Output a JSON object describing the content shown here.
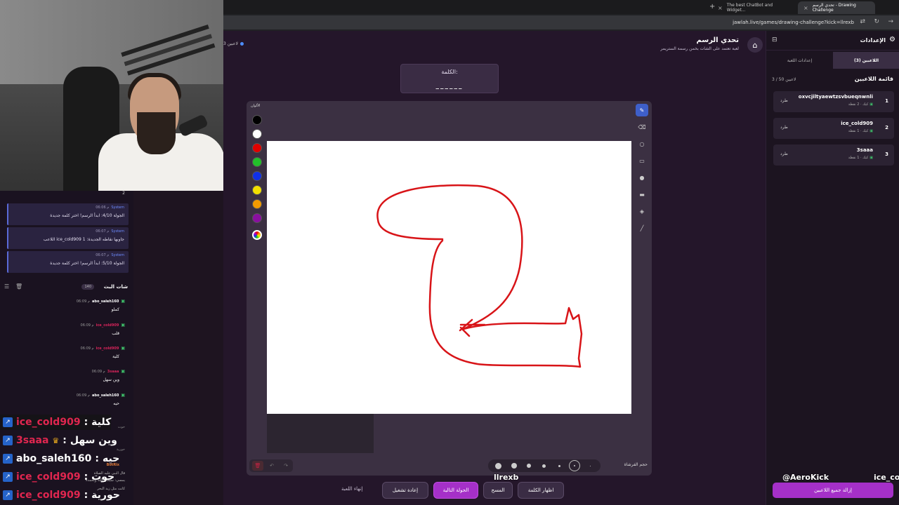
{
  "browser": {
    "tabs": [
      {
        "label": "تحدي الرسم - Drawing Challenge",
        "active": true
      },
      {
        "label": "The best ChatBot and Widget...",
        "active": false
      }
    ],
    "url": "jawlah.live/games/drawing-challenge?kick=llrexb"
  },
  "left_panel": {
    "system_messages": [
      {
        "sender": "System",
        "time": "06:06 م",
        "text": "الجولة 4/10: ابدأ الرسم! اختر كلمة جديدة"
      },
      {
        "sender": "System",
        "time": "06:07 م",
        "text": "اللاعب ice_cold909 جاوبها نقاطه الجديدة: 1"
      },
      {
        "sender": "System",
        "time": "06:07 م",
        "text": "الجولة 5/10: ابدأ الرسم! اختر كلمة جديدة"
      }
    ],
    "chat_title": "شات البث",
    "chat_count": "140",
    "chat_messages": [
      {
        "user": "abo_saleh160",
        "time": "06:09 م",
        "text": "كملو",
        "color": "white"
      },
      {
        "user": "ice_cold909",
        "time": "06:09 م",
        "text": "قلب",
        "color": "red"
      },
      {
        "user": "ice_cold909",
        "time": "06:09 م",
        "text": "كلية",
        "color": "red"
      },
      {
        "user": "3saaa",
        "time": "06:09 م",
        "text": "وين سهل",
        "color": "red"
      },
      {
        "user": "abo_saleh160",
        "time": "06:09 م",
        "text": "حيه",
        "color": "white"
      }
    ],
    "partial_lines": [
      "حوت",
      "حورية",
      "BotRix",
      "قال النبي عليه الصلاة",
      "يمسي: سبحان الله وبحمده",
      "كانت مثل زبد البحر"
    ]
  },
  "overlay_chat": [
    {
      "user": "ice_cold909",
      "sep": ":",
      "msg": "كلية",
      "user_color": "#e0264f",
      "crown": false
    },
    {
      "user": "3saaa",
      "sep": ":",
      "msg": "وين سهل",
      "user_color": "#e0264f",
      "crown": true
    },
    {
      "user": "abo_saleh160",
      "sep": ":",
      "msg": "حيه",
      "user_color": "#ffffff",
      "crown": false
    },
    {
      "user": "ice_cold909",
      "sep": ":",
      "msg": "حوت",
      "user_color": "#e0264f",
      "crown": false
    },
    {
      "user": "ice_cold909",
      "sep": ":",
      "msg": "حورية",
      "user_color": "#e0264f",
      "crown": false
    }
  ],
  "game": {
    "players_online": "3 لاعبين",
    "title": "تحدي الرسم",
    "subtitle": "لعبة تعتمد على الشات بخمن رسمة الستريمر",
    "word_label": "الكلمة:",
    "word_mask": "______",
    "colors_label": "الألوان",
    "palette": [
      "#000000",
      "#ffffff",
      "#e00000",
      "#22c02a",
      "#1030e8",
      "#f2e000",
      "#f29a00",
      "#8a0fa0"
    ],
    "brush_size_label": "حجم الفرشاة",
    "tools": [
      "pencil-icon",
      "eraser-icon",
      "circle-icon",
      "rectangle-icon",
      "dot-icon",
      "square-fill-icon",
      "bucket-icon",
      "line-icon"
    ]
  },
  "actions": {
    "end_game": "إنهاء اللعبة",
    "restart": "إعادة تشغيل",
    "next_round": "الجولة التالية",
    "clear": "المسح",
    "reveal_word": "اظهار الكلمة"
  },
  "sidebar": {
    "title": "الإعدادات",
    "tab_players": "اللاعبين (3)",
    "tab_settings": "إعدادات اللعبة",
    "list_title": "قائمة اللاعبين",
    "list_count": "3 / 50 لاعبين",
    "kick_label": "طرد",
    "players": [
      {
        "rank": "1",
        "name": "oxvcjiltyaewtzsvbueqnwnli",
        "points": "كيك · 2 نقطة"
      },
      {
        "rank": "2",
        "name": "ice_cold909",
        "points": "كيك · 1 نقطة"
      },
      {
        "rank": "3",
        "name": "3saaa",
        "points": "كيك · 1 نقطة"
      }
    ],
    "remove_all": "إزالة جميع اللاعبين"
  },
  "name_tags": {
    "center": "llrexb",
    "right1": "@AeroKick",
    "right2": "ice_col"
  },
  "webcam_count": "2"
}
